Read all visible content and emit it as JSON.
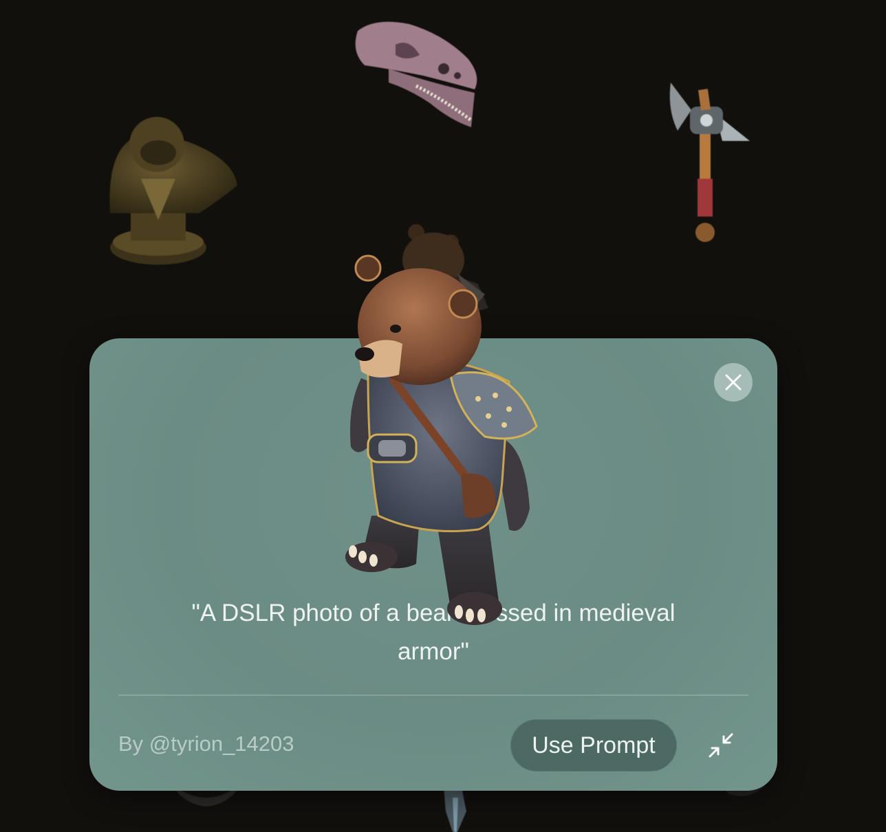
{
  "background_models": [
    {
      "name": "gorilla-bust"
    },
    {
      "name": "dinosaur-skull"
    },
    {
      "name": "battle-axe"
    },
    {
      "name": "bear-figure"
    }
  ],
  "modal": {
    "prompt": "\"A DSLR photo of a bear dressed in medieval armor\"",
    "author": "By @tyrion_14203",
    "use_prompt_label": "Use Prompt",
    "close_icon": "close-icon",
    "minimize_icon": "minimize-icon",
    "model_name": "bear-in-medieval-armor"
  },
  "colors": {
    "page_background": "#12100d",
    "card_background": "#6b8c84",
    "button_background": "#4c6a63",
    "text": "#eef3f1",
    "muted_text": "#b8cdc7"
  }
}
